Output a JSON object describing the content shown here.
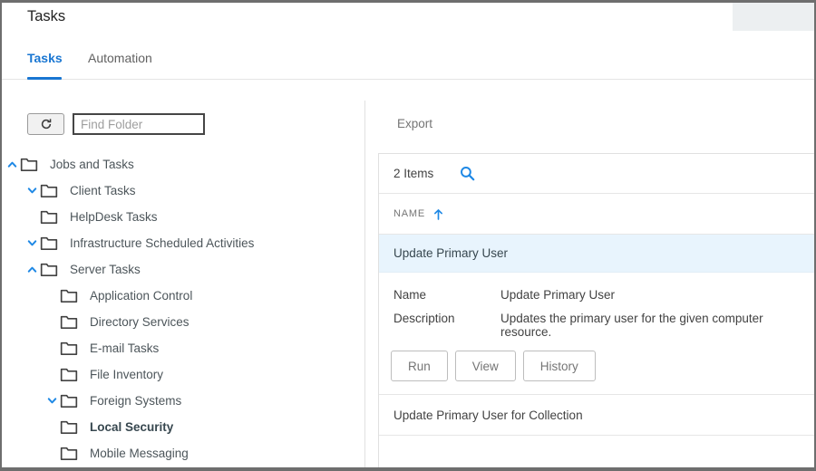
{
  "window": {
    "title": "Tasks"
  },
  "tabs": [
    {
      "label": "Tasks",
      "active": true
    },
    {
      "label": "Automation",
      "active": false
    }
  ],
  "left_panel": {
    "find_folder_placeholder": "Find Folder",
    "tree": [
      {
        "label": "Jobs and Tasks",
        "level": 0,
        "chevron": "up",
        "bold": false
      },
      {
        "label": "Client Tasks",
        "level": 1,
        "chevron": "down",
        "bold": false
      },
      {
        "label": "HelpDesk Tasks",
        "level": 1,
        "chevron": "none",
        "bold": false
      },
      {
        "label": "Infrastructure Scheduled Activities",
        "level": 1,
        "chevron": "down",
        "bold": false
      },
      {
        "label": "Server Tasks",
        "level": 1,
        "chevron": "up",
        "bold": false
      },
      {
        "label": "Application Control",
        "level": 2,
        "chevron": "none",
        "bold": false
      },
      {
        "label": "Directory Services",
        "level": 2,
        "chevron": "none",
        "bold": false
      },
      {
        "label": "E-mail Tasks",
        "level": 2,
        "chevron": "none",
        "bold": false
      },
      {
        "label": "File Inventory",
        "level": 2,
        "chevron": "none",
        "bold": false
      },
      {
        "label": "Foreign Systems",
        "level": 2,
        "chevron": "down",
        "bold": false
      },
      {
        "label": "Local Security",
        "level": 2,
        "chevron": "none",
        "bold": true
      },
      {
        "label": "Mobile Messaging",
        "level": 2,
        "chevron": "none",
        "bold": false
      }
    ]
  },
  "right_panel": {
    "export_label": "Export",
    "items_count": "2 Items",
    "column_header": "NAME",
    "sort_direction": "ascending",
    "rows": [
      {
        "name": "Update Primary User",
        "selected": true
      },
      {
        "name": "Update Primary User for Collection",
        "selected": false
      }
    ],
    "details": {
      "name_label": "Name",
      "name_value": "Update Primary User",
      "description_label": "Description",
      "description_value": "Updates the primary user for the given computer resource.",
      "buttons": [
        "Run",
        "View",
        "History"
      ]
    }
  },
  "colors": {
    "accent": "#1e88e5",
    "tab_active": "#1976d2",
    "selected_row_bg": "#e8f4fd",
    "folder_icon": "#424242",
    "window_border": "#6e6e6e"
  }
}
